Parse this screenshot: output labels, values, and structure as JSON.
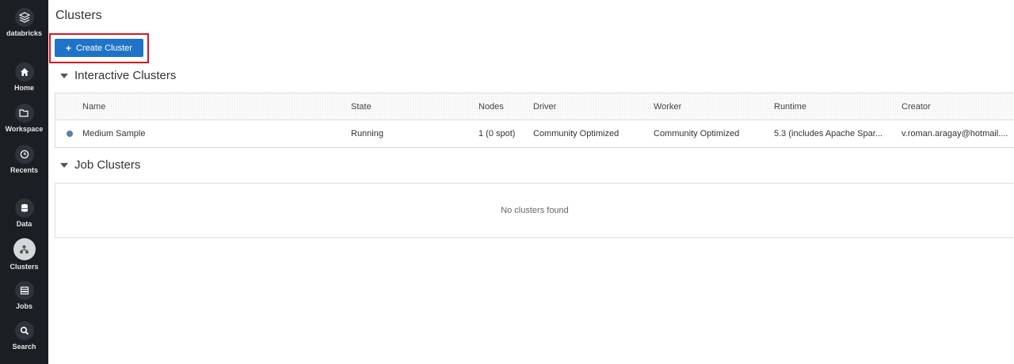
{
  "sidebar": {
    "brand_label": "databricks",
    "items": [
      {
        "label": "Home",
        "icon": "home-icon"
      },
      {
        "label": "Workspace",
        "icon": "folder-icon"
      },
      {
        "label": "Recents",
        "icon": "clock-icon"
      },
      {
        "label": "Data",
        "icon": "database-icon"
      },
      {
        "label": "Clusters",
        "icon": "clusters-icon",
        "active": true
      },
      {
        "label": "Jobs",
        "icon": "calendar-icon"
      },
      {
        "label": "Search",
        "icon": "search-icon"
      }
    ]
  },
  "page": {
    "title": "Clusters",
    "create_button": "Create Cluster",
    "create_button_icon": "+"
  },
  "interactive": {
    "title": "Interactive Clusters",
    "columns": [
      "Name",
      "State",
      "Nodes",
      "Driver",
      "Worker",
      "Runtime",
      "Creator"
    ],
    "rows": [
      {
        "name": "Medium Sample",
        "state": "Running",
        "nodes": "1 (0 spot)",
        "driver": "Community Optimized",
        "worker": "Community Optimized",
        "runtime": "5.3 (includes Apache Spar...",
        "creator": "v.roman.aragay@hotmail...."
      }
    ]
  },
  "jobs": {
    "title": "Job Clusters",
    "empty_text": "No clusters found"
  },
  "colors": {
    "sidebar_bg": "#1b1f24",
    "primary_button": "#1f74c9",
    "highlight": "#d9161e",
    "status_dot": "#5c7fa8"
  }
}
